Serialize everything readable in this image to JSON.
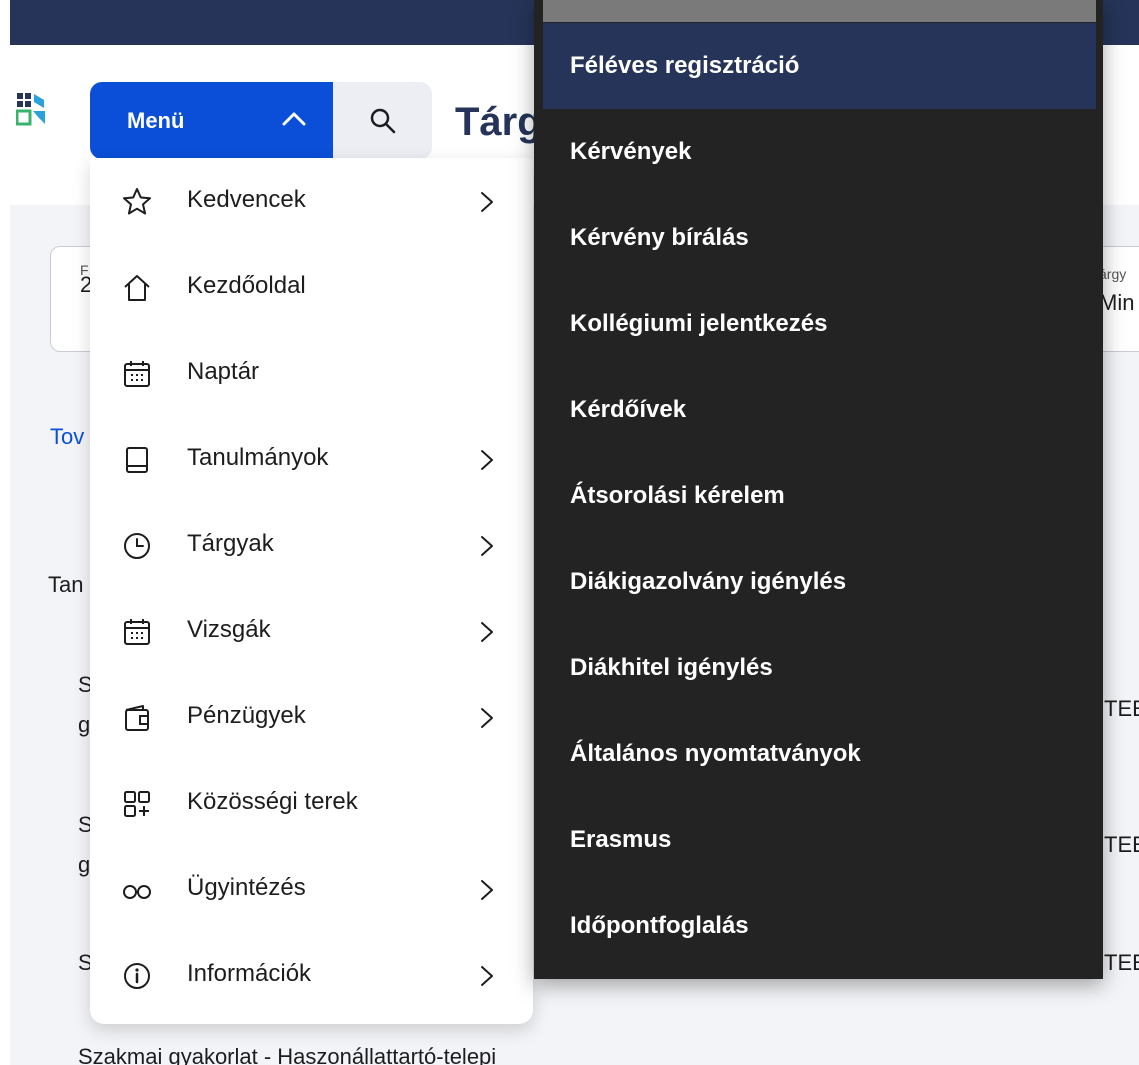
{
  "header": {
    "menu_label": "Menü",
    "page_title": "Tárgyak",
    "logo_icon": "neptun-logo-icon",
    "search_icon": "search-icon",
    "menu_chevron_icon": "chevron-up-icon"
  },
  "colors": {
    "top_bar": "#253458",
    "menu_button": "#0b4fd8",
    "submenu_bg": "#232323",
    "submenu_active": "#253458",
    "content_bg": "#f3f4f7"
  },
  "background_fragments": {
    "card_left_label": "F",
    "card_left_value": "2",
    "card_right_label": "árgy",
    "card_right_value": "Min",
    "link_fragment": "Tov",
    "section_fragment": "Tan",
    "row1_a": "S",
    "row1_b": "g",
    "row1_right": "TEE",
    "row2_a": "S",
    "row2_b": "g",
    "row2_right": "TEE",
    "row3_a": "S",
    "row3_right": "TEE",
    "bottom_text": "Szakmai gyakorlat - Haszonállattartó-telepi"
  },
  "menu": {
    "items": [
      {
        "label": "Kedvencek",
        "icon": "star-icon",
        "has_submenu": true
      },
      {
        "label": "Kezdőoldal",
        "icon": "home-icon",
        "has_submenu": false
      },
      {
        "label": "Naptár",
        "icon": "calendar-icon",
        "has_submenu": false
      },
      {
        "label": "Tanulmányok",
        "icon": "book-icon",
        "has_submenu": true
      },
      {
        "label": "Tárgyak",
        "icon": "clock-icon",
        "has_submenu": true
      },
      {
        "label": "Vizsgák",
        "icon": "calendar-icon",
        "has_submenu": true
      },
      {
        "label": "Pénzügyek",
        "icon": "wallet-icon",
        "has_submenu": true
      },
      {
        "label": "Közösségi terek",
        "icon": "grid-plus-icon",
        "has_submenu": false
      },
      {
        "label": "Ügyintézés",
        "icon": "glasses-icon",
        "has_submenu": true
      },
      {
        "label": "Információk",
        "icon": "info-icon",
        "has_submenu": true
      }
    ]
  },
  "submenu": {
    "active_index": 0,
    "items": [
      "Féléves regisztráció",
      "Kérvények",
      "Kérvény bírálás",
      "Kollégiumi jelentkezés",
      "Kérdőívek",
      "Átsorolási kérelem",
      "Diákigazolvány igénylés",
      "Diákhitel igénylés",
      "Általános nyomtatványok",
      "Erasmus",
      "Időpontfoglalás"
    ]
  }
}
